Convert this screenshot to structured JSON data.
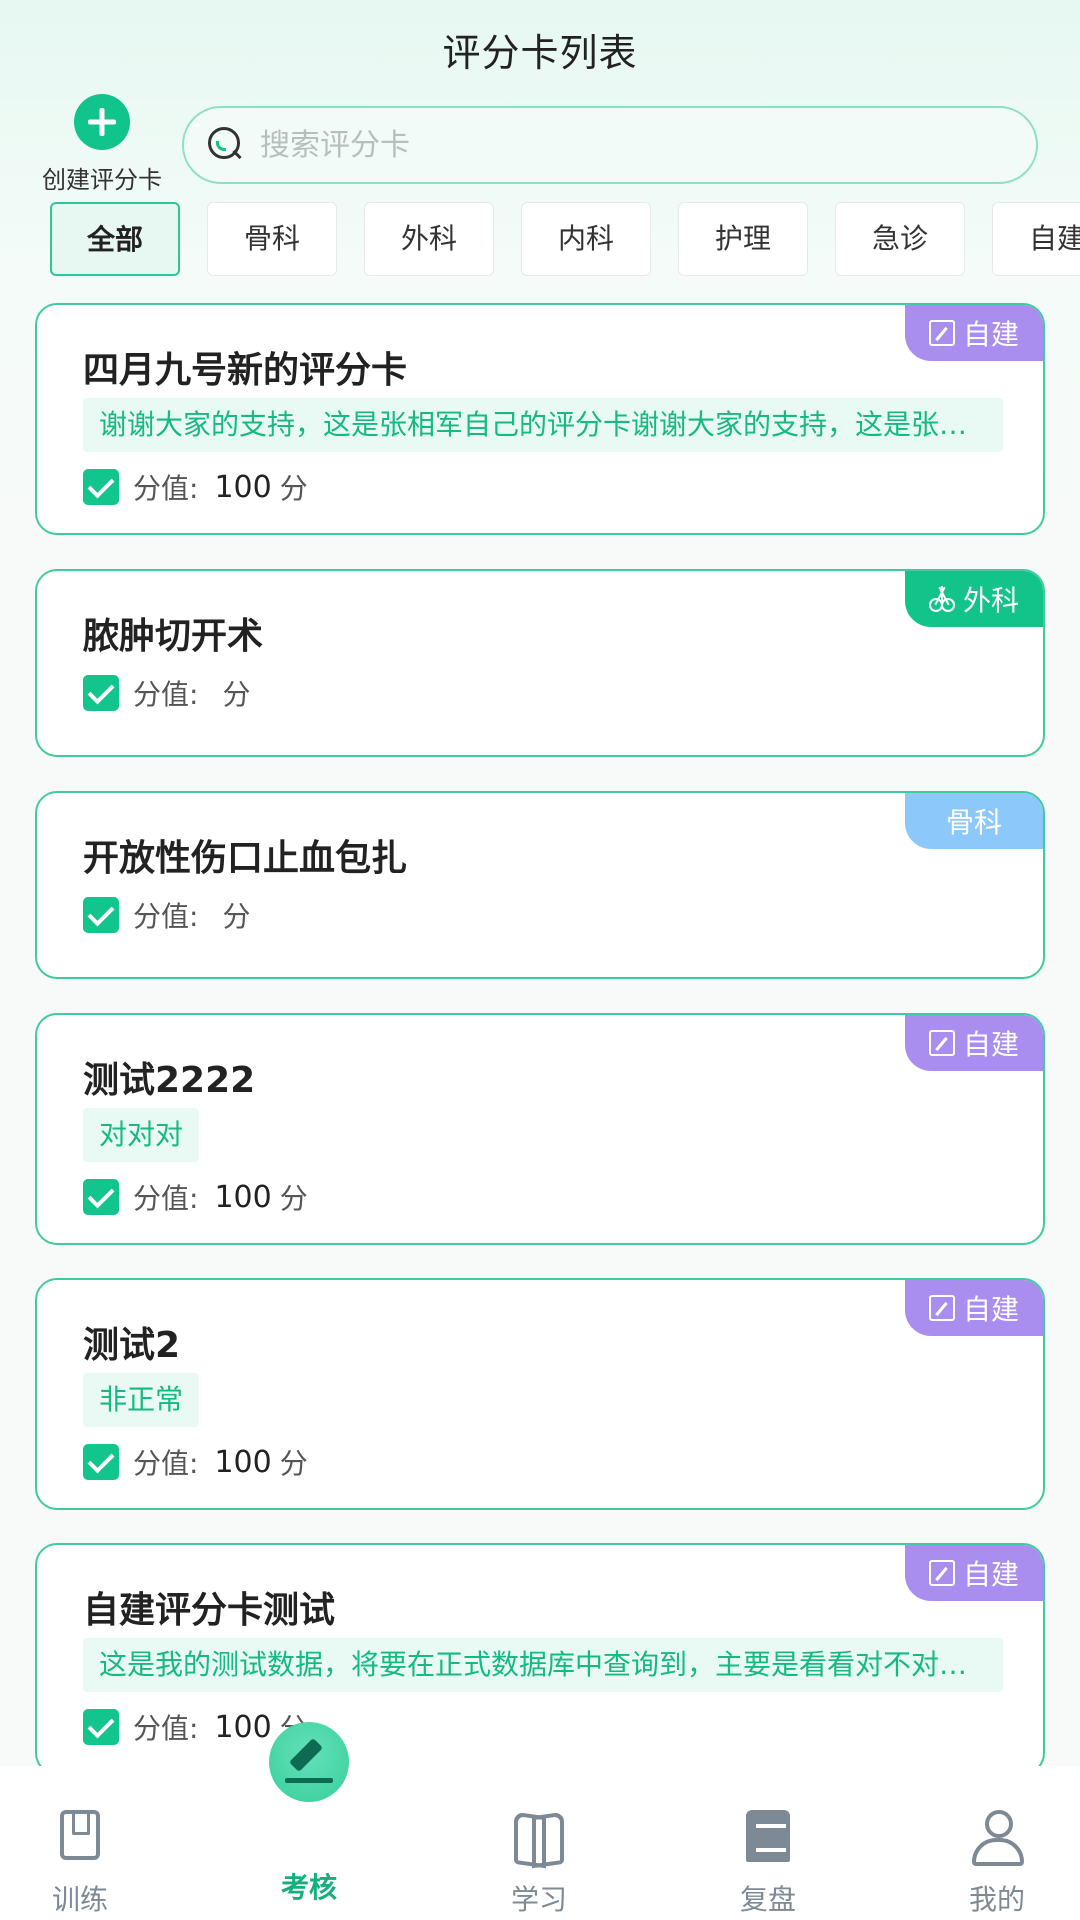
{
  "header": {
    "title": "评分卡列表"
  },
  "create": {
    "label": "创建评分卡"
  },
  "search": {
    "placeholder": "搜索评分卡"
  },
  "tabs": [
    {
      "label": "全部",
      "active": true
    },
    {
      "label": "骨科"
    },
    {
      "label": "外科"
    },
    {
      "label": "内科"
    },
    {
      "label": "护理"
    },
    {
      "label": "急诊"
    },
    {
      "label": "自建"
    }
  ],
  "score_label": "分值:",
  "unit": "分",
  "cards": [
    {
      "title": "四月九号新的评分卡",
      "desc": "谢谢大家的支持，这是张相军自己的评分卡谢谢大家的支持，这是张相军自己的评分卡",
      "score": "100",
      "badge": "自建"
    },
    {
      "title": "脓肿切开术",
      "desc": "",
      "score": "",
      "badge": "外科"
    },
    {
      "title": "开放性伤口止血包扎",
      "desc": "",
      "score": "",
      "badge": "骨科"
    },
    {
      "title": "测试2222",
      "desc": "对对对",
      "score": "100",
      "badge": "自建"
    },
    {
      "title": "测试2",
      "desc": "非正常",
      "score": "100",
      "badge": "自建"
    },
    {
      "title": "自建评分卡测试",
      "desc": "这是我的测试数据，将要在正式数据库中查询到，主要是看看对不对的问题",
      "score": "100",
      "badge": "自建"
    }
  ],
  "colors": {
    "accent": "#12c58c",
    "badge_purple": "#a98ef0",
    "badge_green": "#13c48a",
    "badge_blue": "#8cc9fa"
  },
  "nav": [
    {
      "label": "训练",
      "icon": "book-icon"
    },
    {
      "label": "考核",
      "icon": "pen-icon",
      "active": true
    },
    {
      "label": "学习",
      "icon": "open-book-icon"
    },
    {
      "label": "复盘",
      "icon": "review-icon"
    },
    {
      "label": "我的",
      "icon": "user-icon"
    }
  ]
}
